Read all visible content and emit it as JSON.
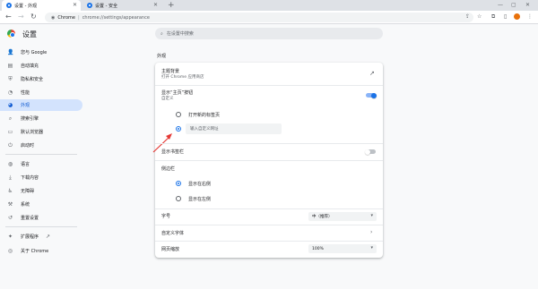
{
  "tabs": [
    {
      "title": "设置 - 外观",
      "active": true
    },
    {
      "title": "设置 - 安全",
      "active": false
    }
  ],
  "toolbar": {
    "chip": "Chrome",
    "url": "chrome://settings/appearance"
  },
  "header": {
    "title": "设置",
    "search_placeholder": "在设置中搜索"
  },
  "sidebar": {
    "items": [
      {
        "label": "您与 Google",
        "icon": "person-icon"
      },
      {
        "label": "自动填充",
        "icon": "autofill-icon"
      },
      {
        "label": "隐私和安全",
        "icon": "shield-icon"
      },
      {
        "label": "性能",
        "icon": "speedometer-icon"
      },
      {
        "label": "外观",
        "icon": "palette-icon",
        "active": true
      },
      {
        "label": "搜索引擎",
        "icon": "search-icon"
      },
      {
        "label": "默认浏览器",
        "icon": "browser-icon"
      },
      {
        "label": "启动时",
        "icon": "power-icon"
      },
      {
        "label": "语言",
        "icon": "globe-icon"
      },
      {
        "label": "下载内容",
        "icon": "download-icon"
      },
      {
        "label": "无障碍",
        "icon": "accessibility-icon"
      },
      {
        "label": "系统",
        "icon": "wrench-icon"
      },
      {
        "label": "重置设置",
        "icon": "reset-icon"
      },
      {
        "label": "扩展程序",
        "icon": "puzzle-icon"
      },
      {
        "label": "关于 Chrome",
        "icon": "chrome-icon"
      }
    ]
  },
  "main": {
    "section_title": "外观",
    "theme": {
      "label": "主题背景",
      "sub": "打开 Chrome 应用商店"
    },
    "home_button": {
      "label": "显示“主页”按钮",
      "sub": "自定义",
      "enabled": true
    },
    "home_options": {
      "newtab": "打开新的标签页",
      "custom_placeholder": "输入自定义网址",
      "selected": "custom"
    },
    "bookmarks_bar": {
      "label": "显示书签栏",
      "enabled": false
    },
    "side_panel": {
      "label": "侧边栏",
      "right": "显示在右侧",
      "left": "显示在左侧",
      "selected": "right"
    },
    "font_size": {
      "label": "字号",
      "value": "中（推荐）"
    },
    "custom_fonts": {
      "label": "自定义字体"
    },
    "page_zoom": {
      "label": "网页缩放",
      "value": "100%"
    }
  },
  "colors": {
    "accent": "#1a73e8",
    "annotation_arrow": "#e53935"
  }
}
